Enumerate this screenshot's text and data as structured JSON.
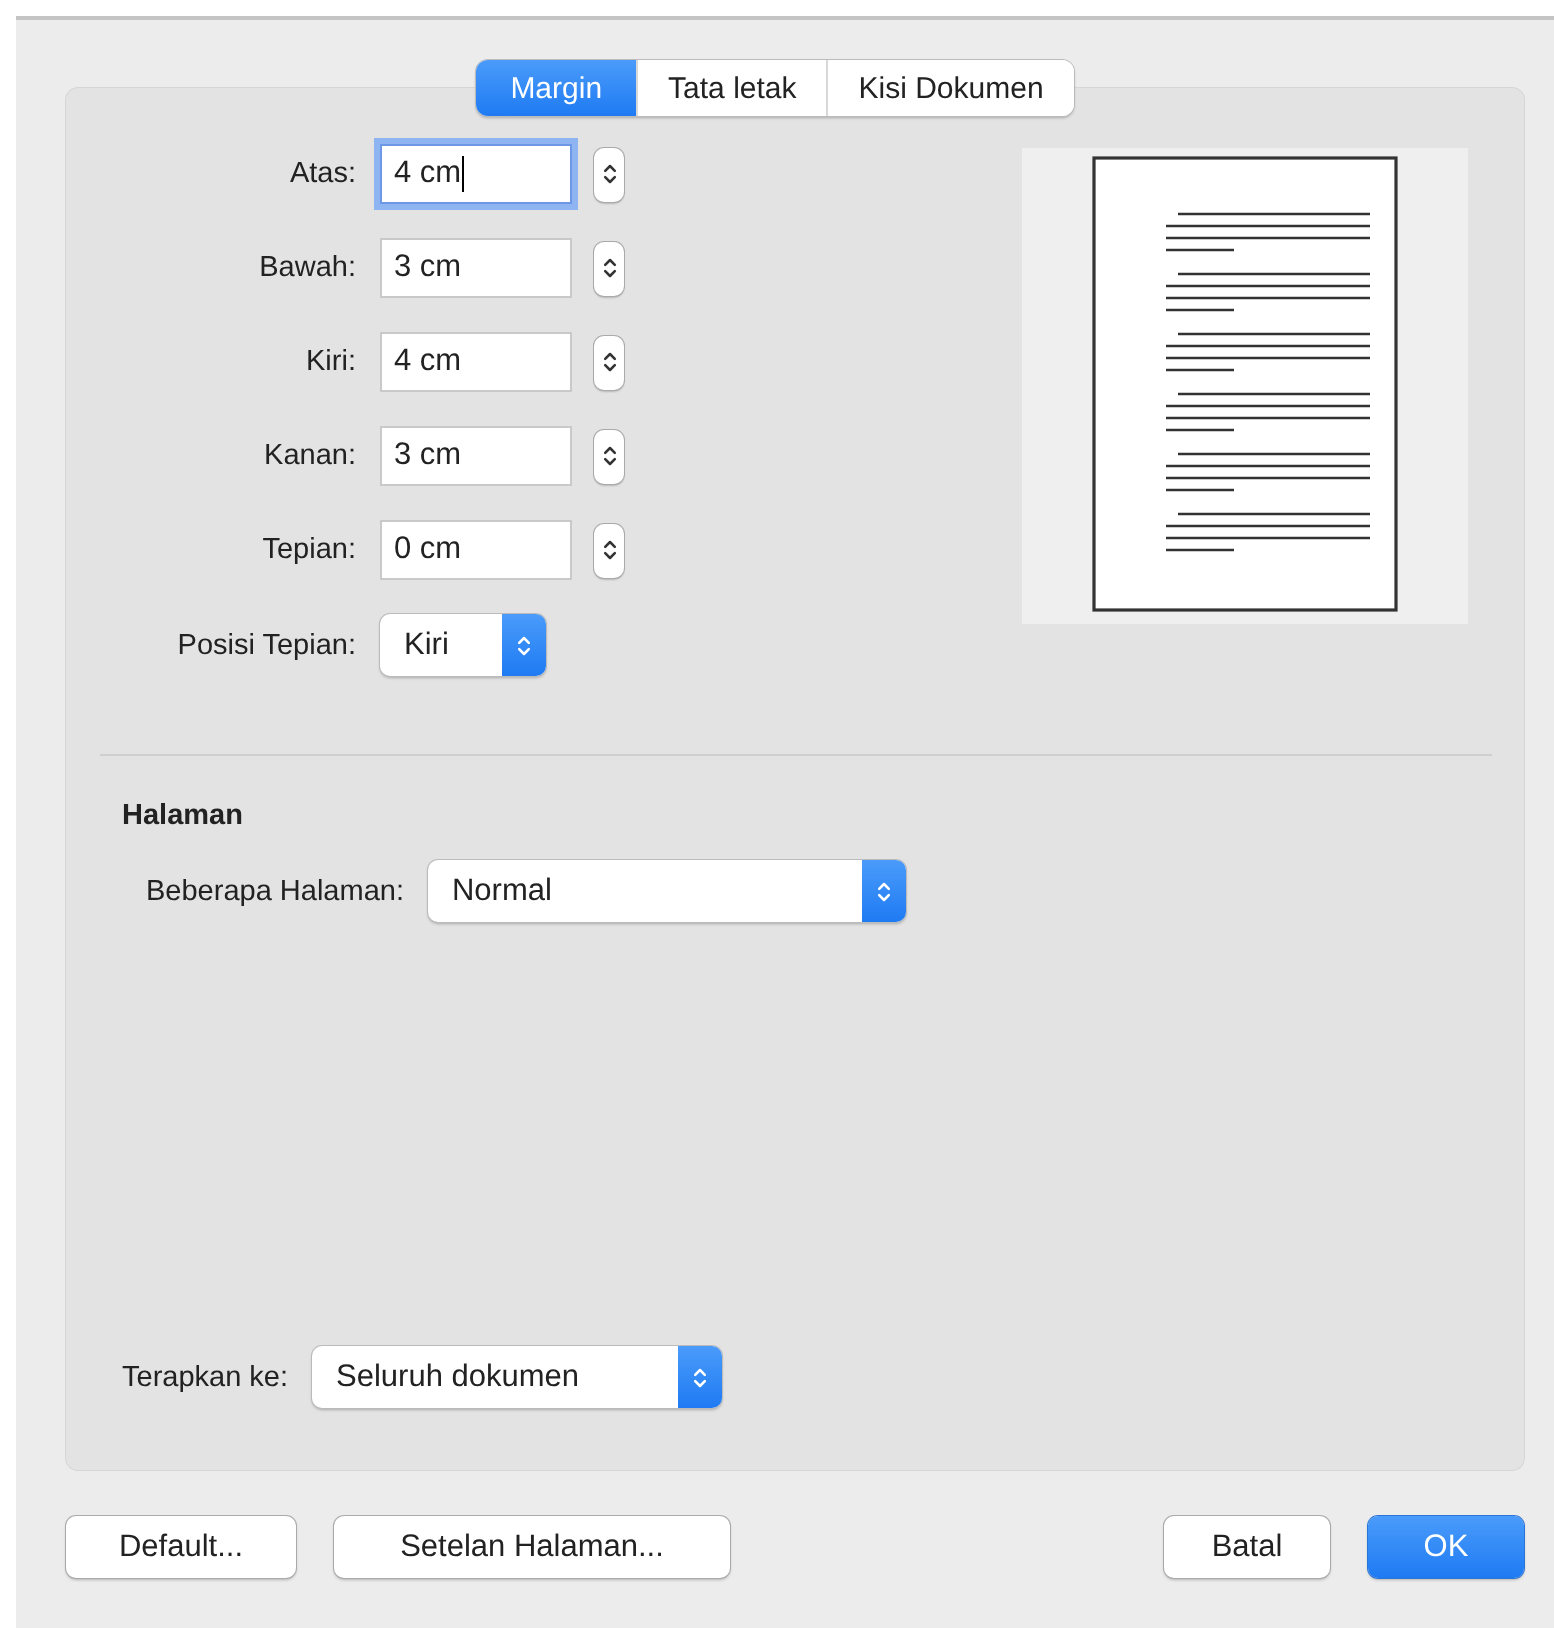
{
  "tabs": [
    {
      "label": "Margin",
      "selected": true
    },
    {
      "label": "Tata letak",
      "selected": false
    },
    {
      "label": "Kisi Dokumen",
      "selected": false
    }
  ],
  "margin_fields": [
    {
      "label": "Atas:",
      "value": "4 cm",
      "focused": true
    },
    {
      "label": "Bawah:",
      "value": "3 cm",
      "focused": false
    },
    {
      "label": "Kiri:",
      "value": "4 cm",
      "focused": false
    },
    {
      "label": "Kanan:",
      "value": "3 cm",
      "focused": false
    },
    {
      "label": "Tepian:",
      "value": "0 cm",
      "focused": false
    }
  ],
  "edge_position": {
    "label": "Posisi Tepian:",
    "value": "Kiri"
  },
  "pages_section": {
    "title": "Halaman",
    "multiple_pages": {
      "label": "Beberapa Halaman:",
      "value": "Normal"
    }
  },
  "apply_to": {
    "label": "Terapkan ke:",
    "value": "Seluruh dokumen"
  },
  "left_buttons": [
    {
      "label": "Default...",
      "kind": "normal"
    },
    {
      "label": "Setelan Halaman...",
      "kind": "normal"
    }
  ],
  "right_buttons": [
    {
      "label": "Batal",
      "kind": "normal"
    },
    {
      "label": "OK",
      "kind": "default"
    }
  ]
}
